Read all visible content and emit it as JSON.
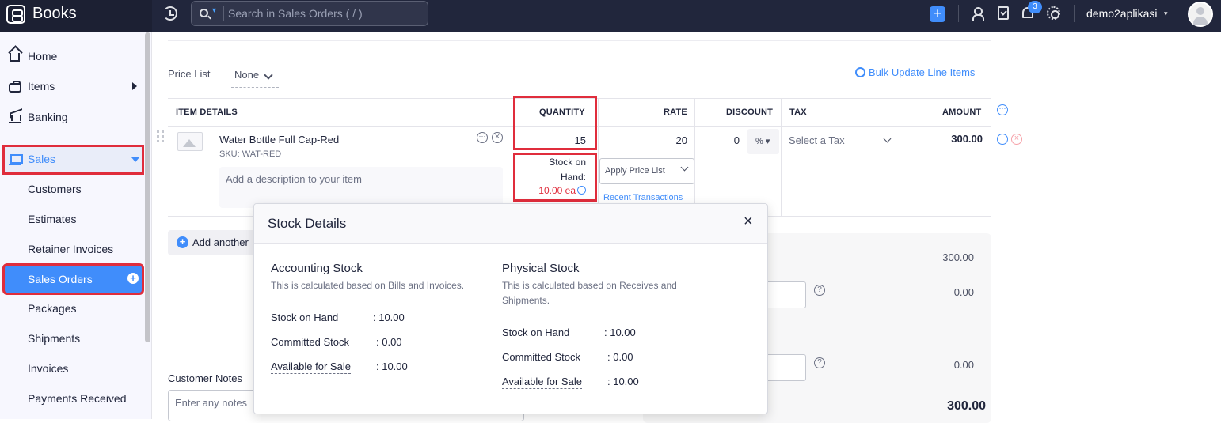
{
  "app": {
    "name": "Books",
    "search_placeholder": "Search in Sales Orders ( / )",
    "add_symbol": "+",
    "notification_count": "3",
    "org_name": "demo2aplikasi",
    "org_caret": "▾"
  },
  "sidebar": {
    "items": [
      {
        "label": "Home"
      },
      {
        "label": "Items"
      },
      {
        "label": "Banking"
      },
      {
        "label": "Sales"
      }
    ],
    "sales_sub": [
      {
        "label": "Customers"
      },
      {
        "label": "Estimates"
      },
      {
        "label": "Retainer Invoices"
      },
      {
        "label": "Sales Orders"
      },
      {
        "label": "Packages"
      },
      {
        "label": "Shipments"
      },
      {
        "label": "Invoices"
      },
      {
        "label": "Payments Received"
      }
    ],
    "plus_symbol": "+"
  },
  "price_list": {
    "label": "Price List",
    "value": "None"
  },
  "bulk_update": "Bulk Update Line Items",
  "table": {
    "headers": {
      "item": "ITEM DETAILS",
      "quantity": "QUANTITY",
      "rate": "RATE",
      "discount": "DISCOUNT",
      "tax": "TAX",
      "amount": "AMOUNT"
    },
    "row": {
      "name": "Water Bottle Full Cap-Red",
      "sku": "SKU: WAT-RED",
      "description_placeholder": "Add a description to your item",
      "quantity": "15",
      "stock_label": "Stock on Hand:",
      "stock_value": "10.00 ea",
      "rate": "20",
      "apply_price_list": "Apply Price List",
      "recent_transactions": "Recent Transactions",
      "discount": "0",
      "discount_unit": "% ▾",
      "tax_placeholder": "Select a Tax",
      "amount": "300.00"
    },
    "icons": {
      "more": "···",
      "close": "×"
    }
  },
  "add_row": "Add another",
  "totals": {
    "subtotal": "300.00",
    "adjustment1": "0.00",
    "adjustment2": "0.00",
    "total": "300.00",
    "help": "?"
  },
  "customer_notes": {
    "label": "Customer Notes",
    "placeholder": "Enter any notes"
  },
  "modal": {
    "title": "Stock Details",
    "close": "×",
    "accounting": {
      "title": "Accounting Stock",
      "desc": "This is calculated based on Bills and Invoices.",
      "rows": [
        {
          "label": "Stock on Hand",
          "value": ": 10.00"
        },
        {
          "label": "Committed Stock",
          "value": ": 0.00"
        },
        {
          "label": "Available for Sale",
          "value": ": 10.00"
        }
      ]
    },
    "physical": {
      "title": "Physical Stock",
      "desc": "This is calculated based on Receives and Shipments.",
      "rows": [
        {
          "label": "Stock on Hand",
          "value": ": 10.00"
        },
        {
          "label": "Committed Stock",
          "value": ": 0.00"
        },
        {
          "label": "Available for Sale",
          "value": ": 10.00"
        }
      ]
    }
  },
  "colors": {
    "accent": "#408dfb",
    "topbar": "#21263c",
    "highlight": "#e02d3c"
  }
}
